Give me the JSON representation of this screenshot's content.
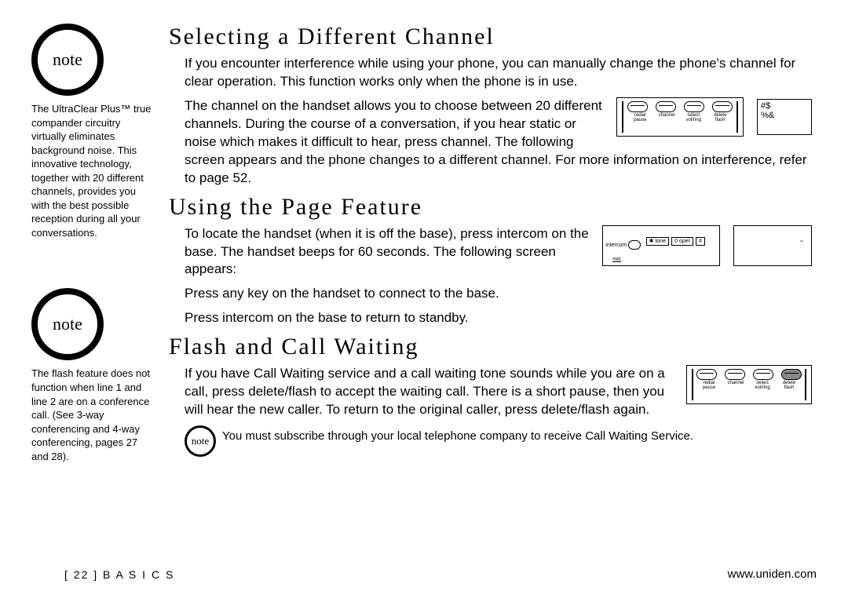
{
  "sidebar": {
    "note_label": "note",
    "note1_text": "The UltraClear Plus™ true compander circuitry virtually eliminates background noise. This innovative technology, together with 20 different channels, provides you with the best possible reception during all your conversations.",
    "note2_text": "The flash feature does not function when line 1 and line 2 are on a conference call. (See 3-way conferencing and 4-way conferencing, pages 27 and 28)."
  },
  "sections": {
    "s1": {
      "heading": "Selecting a Different Channel",
      "p1": "If you encounter interference while using your phone, you can manually change the phone's channel for clear operation. This function works only when the phone is in use.",
      "p2a": "The channel on the handset allows you to choose between 20 different channels. During the course of a conversation, if you hear static or noise which makes it difficult to hear, press channel. The following screen",
      "p2b": "appears and the phone changes to a different channel. For more information on interference, refer to page 52."
    },
    "s2": {
      "heading": "Using the Page Feature",
      "p1a": "To locate the handset (when it is off the base), press intercom on the base. The handset beeps for 60 seconds. The following screen appears:",
      "p2": "Press any key on the handset to connect to the base.",
      "p3": "Press intercom on the base to return to standby."
    },
    "s3": {
      "heading": "Flash and Call Waiting",
      "p1a": "If you have Call Waiting service and a call waiting tone sounds while you are on a call, press delete/flash to",
      "p1b": "accept the waiting call. There is a short pause, then you will hear the new caller. To return to the original caller, press delete/flash again.",
      "small_note": "You must subscribe through your local telephone company to receive Call Waiting Service."
    }
  },
  "diagrams": {
    "btn_labels": {
      "redial": "redial",
      "pause": "pause",
      "channel": "channel",
      "select": "select",
      "volring": "vol/ring",
      "delete": "delete",
      "flash": "flash"
    },
    "lcd_b": "#$\n%&",
    "keypad": {
      "intercom": "intercom",
      "mic": "mic",
      "star": "✱ tone",
      "zero": "0 oper",
      "hash": "#"
    },
    "lcd_d": "\"\""
  },
  "footer": {
    "left": "[ 22 ]  B A S I C S",
    "right": "www.uniden.com"
  }
}
